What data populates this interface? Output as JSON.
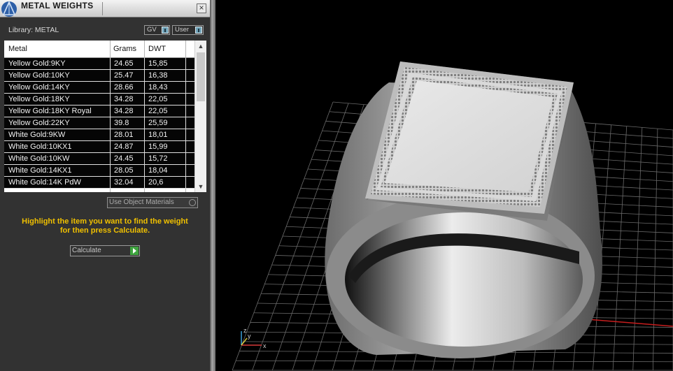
{
  "panel": {
    "title": "METAL WEIGHTS",
    "close_glyph": "×",
    "library_label": "Library: METAL",
    "toggles": [
      {
        "label": "GV"
      },
      {
        "label": "User"
      }
    ],
    "table": {
      "headers": [
        "Metal",
        "Grams",
        "DWT"
      ],
      "rows": [
        [
          "Yellow Gold:9KY",
          "24.65",
          "15,85"
        ],
        [
          "Yellow Gold:10KY",
          "25.47",
          "16,38"
        ],
        [
          "Yellow Gold:14KY",
          "28.66",
          "18,43"
        ],
        [
          "Yellow Gold:18KY",
          "34.28",
          "22,05"
        ],
        [
          "Yellow Gold:18KY Royal",
          "34.28",
          "22,05"
        ],
        [
          "Yellow Gold:22KY",
          "39.8",
          "25,59"
        ],
        [
          "White Gold:9KW",
          "28.01",
          "18,01"
        ],
        [
          "White Gold:10KX1",
          "24.87",
          "15,99"
        ],
        [
          "White Gold:10KW",
          "24.45",
          "15,72"
        ],
        [
          "White Gold:14KX1",
          "28.05",
          "18,04"
        ],
        [
          "White Gold:14K PdW",
          "32.04",
          "20,6"
        ]
      ]
    },
    "use_object_materials_label": "Use Object Materials",
    "instruction_line1": "Highlight the item you want to find the weight",
    "instruction_line2": "for then press Calculate.",
    "calculate_label": "Calculate"
  },
  "viewport": {
    "axis_labels": {
      "z": "z",
      "y": "y",
      "x": "x"
    },
    "colors": {
      "background": "#000000",
      "grid": "#6a6a6a",
      "x_axis": "#c81e1e",
      "y_axis": "#1ea0c8"
    }
  }
}
